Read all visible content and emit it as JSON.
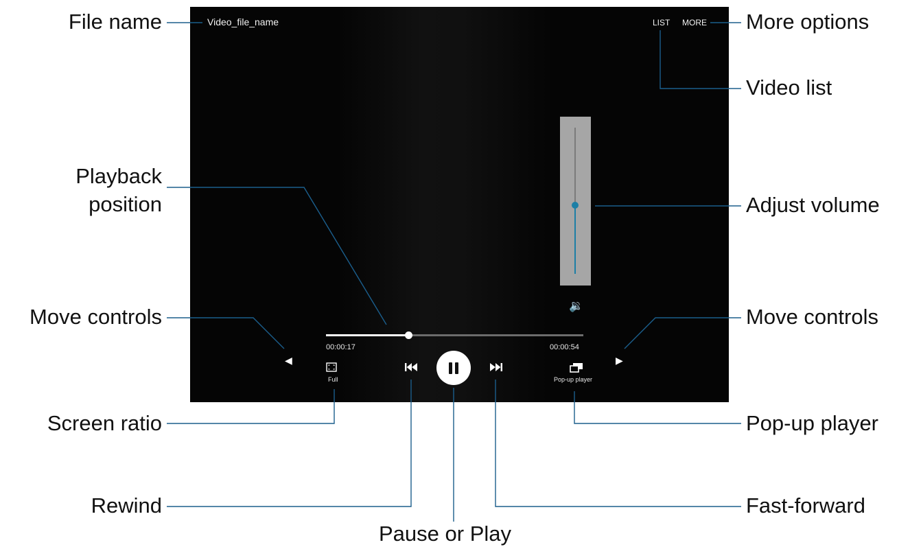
{
  "player": {
    "file_name": "Video_file_name",
    "list_label": "LIST",
    "more_label": "MORE",
    "current_time": "00:00:17",
    "total_time": "00:00:54",
    "playback_fraction": 0.32,
    "volume_fraction": 0.47,
    "full_label": "Full",
    "popup_label": "Pop-up player",
    "accent_color": "#1c7fa6"
  },
  "callouts": {
    "file_name": "File name",
    "more_options": "More options",
    "video_list": "Video list",
    "playback_line1": "Playback",
    "playback_line2": "position",
    "adjust_volume": "Adjust volume",
    "move_controls_left": "Move controls",
    "move_controls_right": "Move controls",
    "screen_ratio": "Screen ratio",
    "popup_player": "Pop-up player",
    "rewind": "Rewind",
    "fast_forward": "Fast-forward",
    "pause_or_play": "Pause or Play"
  },
  "icons": {
    "speaker": "volume-icon",
    "screen_ratio": "screen-ratio-icon",
    "rewind": "rewind-icon",
    "pause": "pause-icon",
    "fast_forward": "fast-forward-icon",
    "popup": "popup-player-icon",
    "left_arrow": "move-left-icon",
    "right_arrow": "move-right-icon"
  }
}
